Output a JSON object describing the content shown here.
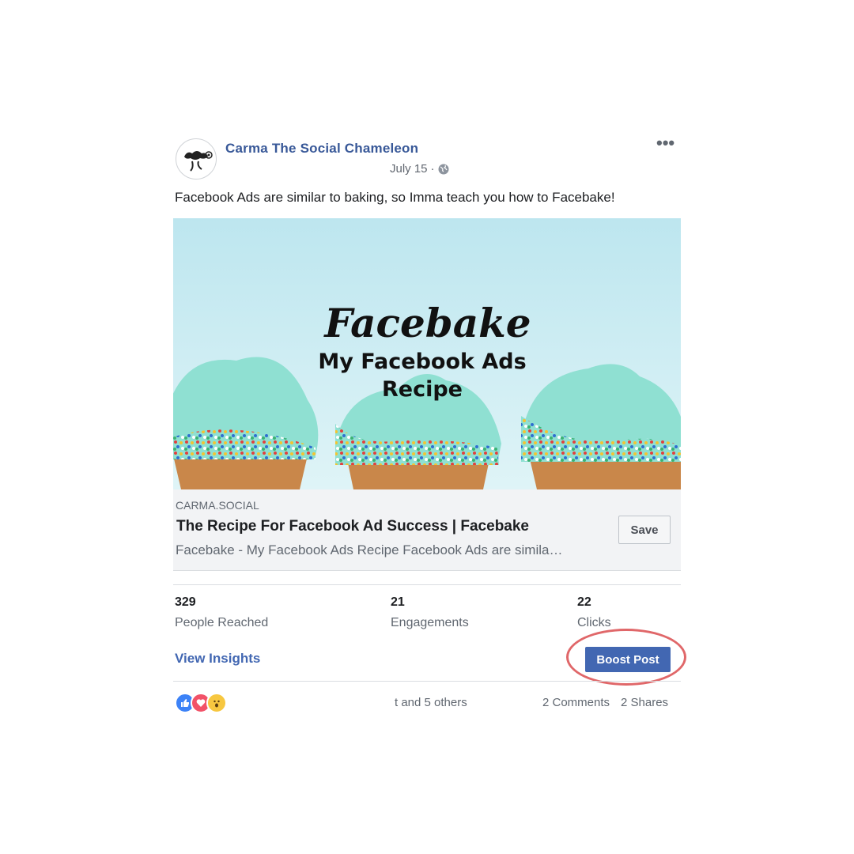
{
  "post": {
    "page_name": "Carma The Social Chameleon",
    "date": "July 15",
    "date_separator": "·",
    "privacy_icon": "globe-icon",
    "more_icon": "more-options-icon",
    "caption": "Facebook Ads are similar to baking, so Imma teach you how to Facebake!"
  },
  "hero": {
    "title_script": "Facebake",
    "line1": "My Facebook Ads",
    "line2": "Recipe",
    "background": "#cfeef4",
    "frosting": "#8fe0d2"
  },
  "link_preview": {
    "domain": "CARMA.SOCIAL",
    "title": "The Recipe For Facebook Ad Success | Facebake",
    "description": "Facebake - My Facebook Ads Recipe Facebook Ads are simila…",
    "save_label": "Save"
  },
  "stats": [
    {
      "value": "329",
      "label": "People Reached"
    },
    {
      "value": "21",
      "label": "Engagements"
    },
    {
      "value": "22",
      "label": "Clicks"
    }
  ],
  "actions": {
    "insights_label": "View Insights",
    "boost_label": "Boost Post",
    "boost_color": "#4267b2",
    "highlight_color": "#e06769"
  },
  "reactions": {
    "icons": [
      "like-icon",
      "love-icon",
      "wow-icon"
    ],
    "others_text": "t and 5 others",
    "comments": "2 Comments",
    "shares": "2 Shares"
  }
}
